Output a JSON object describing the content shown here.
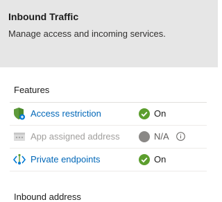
{
  "header": {
    "title": "Inbound Traffic",
    "subtitle": "Manage access and incoming services."
  },
  "features": {
    "title": "Features",
    "rows": [
      {
        "label": "Access restriction",
        "status": "On",
        "icon": "shield-icon",
        "enabled": true
      },
      {
        "label": "App assigned address",
        "status": "N/A",
        "icon": "app-address-icon",
        "enabled": false
      },
      {
        "label": "Private endpoints",
        "status": "On",
        "icon": "private-endpoint-icon",
        "enabled": true
      }
    ]
  },
  "next_section": {
    "title": "Inbound address"
  },
  "colors": {
    "link": "#0067b8",
    "status_on": "#107c10",
    "status_na": "#8a8886"
  }
}
